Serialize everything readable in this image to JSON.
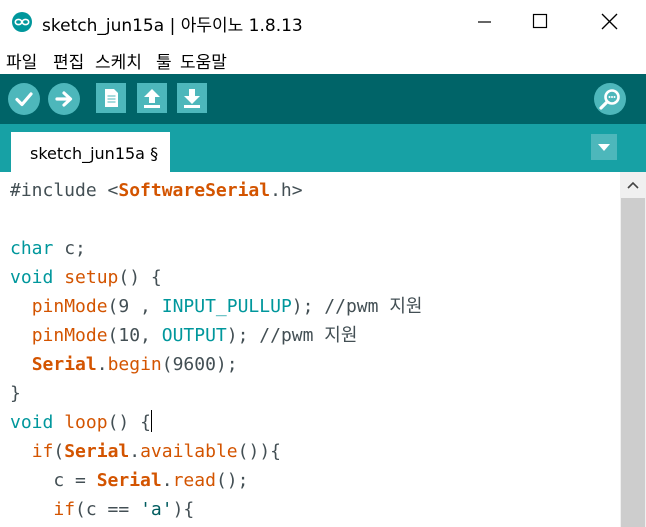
{
  "window": {
    "title": "sketch_jun15a | 아두이노 1.8.13"
  },
  "menu": {
    "items": [
      "파일",
      "편집",
      "스케치",
      "툴",
      "도움말"
    ]
  },
  "toolbar": {
    "buttons": [
      "verify-icon",
      "upload-icon",
      "new-icon",
      "open-icon",
      "save-icon",
      "serial-monitor-icon"
    ]
  },
  "tabs": [
    {
      "label": "sketch_jun15a §"
    }
  ],
  "editor": {
    "lines": [
      [
        {
          "t": "#include <",
          "c": ""
        },
        {
          "t": "SoftwareSerial",
          "c": "kw-orange-b"
        },
        {
          "t": ".h>",
          "c": ""
        }
      ],
      [],
      [
        {
          "t": "char",
          "c": "kw-teal"
        },
        {
          "t": " c;",
          "c": ""
        }
      ],
      [
        {
          "t": "void",
          "c": "kw-teal"
        },
        {
          "t": " ",
          "c": ""
        },
        {
          "t": "setup",
          "c": "kw-orange"
        },
        {
          "t": "() {",
          "c": ""
        }
      ],
      [
        {
          "t": "  ",
          "c": ""
        },
        {
          "t": "pinMode",
          "c": "kw-orange"
        },
        {
          "t": "(9 , ",
          "c": ""
        },
        {
          "t": "INPUT_PULLUP",
          "c": "kw-teal"
        },
        {
          "t": "); //pwm 지원",
          "c": ""
        }
      ],
      [
        {
          "t": "  ",
          "c": ""
        },
        {
          "t": "pinMode",
          "c": "kw-orange"
        },
        {
          "t": "(10, ",
          "c": ""
        },
        {
          "t": "OUTPUT",
          "c": "kw-teal"
        },
        {
          "t": "); //pwm 지원",
          "c": ""
        }
      ],
      [
        {
          "t": "  ",
          "c": ""
        },
        {
          "t": "Serial",
          "c": "kw-orange-b"
        },
        {
          "t": ".",
          "c": ""
        },
        {
          "t": "begin",
          "c": "kw-orange"
        },
        {
          "t": "(9600);",
          "c": ""
        }
      ],
      [
        {
          "t": "}",
          "c": ""
        }
      ],
      [
        {
          "t": "void",
          "c": "kw-teal"
        },
        {
          "t": " ",
          "c": ""
        },
        {
          "t": "loop",
          "c": "kw-orange"
        },
        {
          "t": "() {",
          "c": ""
        },
        {
          "t": "",
          "c": "caret"
        }
      ],
      [
        {
          "t": "  ",
          "c": ""
        },
        {
          "t": "if",
          "c": "kw-orange"
        },
        {
          "t": "(",
          "c": ""
        },
        {
          "t": "Serial",
          "c": "kw-orange-b"
        },
        {
          "t": ".",
          "c": ""
        },
        {
          "t": "available",
          "c": "kw-orange"
        },
        {
          "t": "()){",
          "c": ""
        }
      ],
      [
        {
          "t": "    c = ",
          "c": ""
        },
        {
          "t": "Serial",
          "c": "kw-orange-b"
        },
        {
          "t": ".",
          "c": ""
        },
        {
          "t": "read",
          "c": "kw-orange"
        },
        {
          "t": "();",
          "c": ""
        }
      ],
      [
        {
          "t": "    ",
          "c": ""
        },
        {
          "t": "if",
          "c": "kw-orange"
        },
        {
          "t": "(c == ",
          "c": ""
        },
        {
          "t": "'a'",
          "c": "kw-str"
        },
        {
          "t": "){",
          "c": ""
        }
      ]
    ]
  },
  "colors": {
    "toolbar": "#006468",
    "tabbar": "#17a1a5",
    "button": "#4db7bb"
  }
}
